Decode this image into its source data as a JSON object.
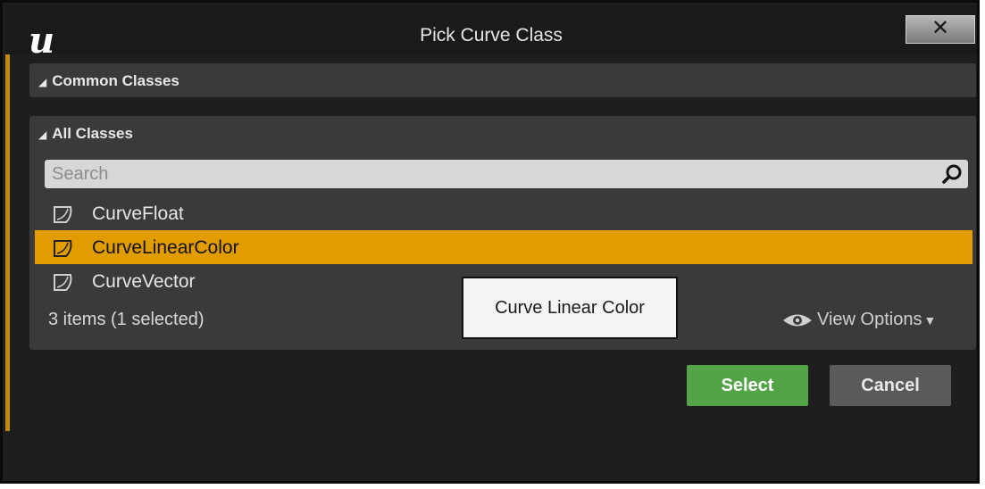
{
  "window": {
    "title": "Pick Curve Class",
    "logo_text": "u",
    "close_label": "✕"
  },
  "sections": {
    "common": {
      "label": "Common Classes",
      "expanded": true
    },
    "all": {
      "label": "All Classes",
      "expanded": true
    }
  },
  "search": {
    "placeholder": "Search",
    "value": ""
  },
  "class_list": {
    "items": [
      {
        "label": "CurveFloat",
        "selected": false
      },
      {
        "label": "CurveLinearColor",
        "selected": true
      },
      {
        "label": "CurveVector",
        "selected": false
      }
    ],
    "status": "3 items (1 selected)",
    "view_options_label": "View Options"
  },
  "tooltip": {
    "text": "Curve Linear Color"
  },
  "buttons": {
    "select": "Select",
    "cancel": "Cancel"
  },
  "colors": {
    "selection": "#e19c00",
    "select_button": "#52a446",
    "background": "#1e1e1e",
    "panel": "#3a3a3a"
  }
}
